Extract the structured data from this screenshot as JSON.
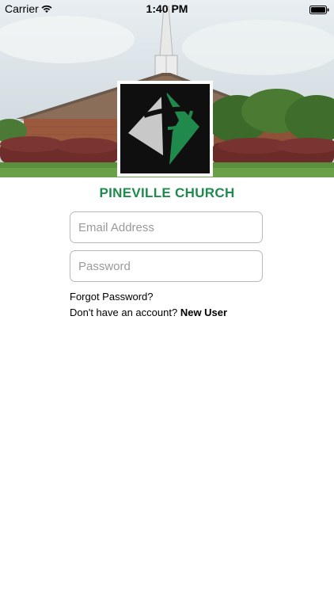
{
  "status_bar": {
    "carrier": "Carrier",
    "time": "1:40 PM",
    "icons": [
      "wifi-icon",
      "battery-icon"
    ]
  },
  "header": {
    "image": "church-building-photo",
    "logo": "church-cross-logo"
  },
  "title": "PINEVILLE CHURCH",
  "form": {
    "email_placeholder": "Email Address",
    "email_value": "",
    "password_placeholder": "Password",
    "password_value": ""
  },
  "links": {
    "forgot_password": "Forgot Password?",
    "no_account_text": "Don't have an account?",
    "new_user": "New User"
  },
  "colors": {
    "brand_green": "#1f8a4c",
    "background": "#ffffff",
    "field_border": "#b9b9b9"
  }
}
